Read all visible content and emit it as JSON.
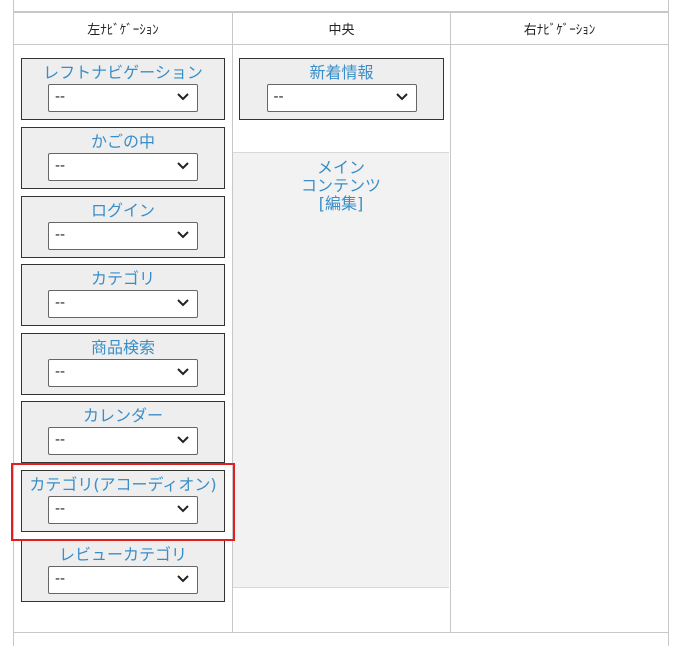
{
  "headers": {
    "left": "左ﾅﾋﾞｹﾞｰｼｮﾝ",
    "center": "中央",
    "right": "右ﾅﾋﾞｹﾞｰｼｮﾝ"
  },
  "left_blocks": [
    {
      "title": "レフトナビゲーション",
      "value": "--"
    },
    {
      "title": "かごの中",
      "value": "--"
    },
    {
      "title": "ログイン",
      "value": "--"
    },
    {
      "title": "カテゴリ",
      "value": "--"
    },
    {
      "title": "商品検索",
      "value": "--"
    },
    {
      "title": "カレンダー",
      "value": "--"
    },
    {
      "title": "カテゴリ(アコーディオン)",
      "value": "--"
    },
    {
      "title": "レビューカテゴリ",
      "value": "--"
    }
  ],
  "center_block": {
    "title": "新着情報",
    "value": "--"
  },
  "main_contents": {
    "line1": "メイン",
    "line2": "コンテンツ",
    "edit_link": "[編集]"
  },
  "colors": {
    "link": "#3a8ec7",
    "block_bg": "#eeeeee",
    "highlight": "#e02020"
  }
}
